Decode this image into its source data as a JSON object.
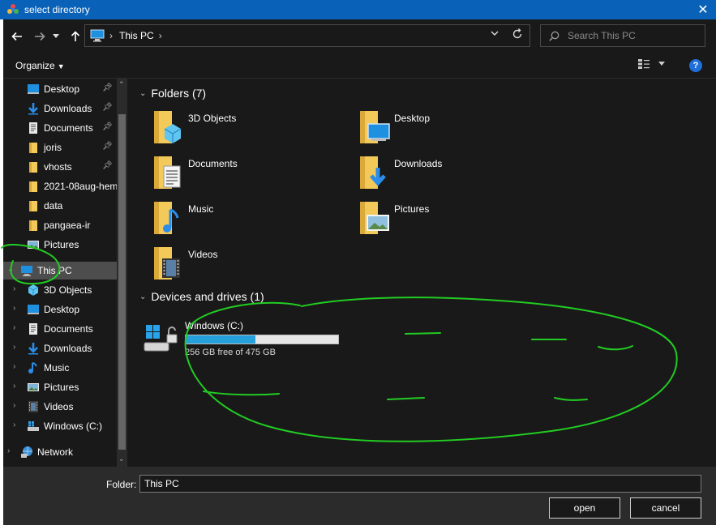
{
  "window": {
    "title": "select directory",
    "close_icon": "close-icon"
  },
  "nav": {
    "back_icon": "arrow-left-icon",
    "forward_icon": "arrow-right-icon",
    "recent_icon": "chevron-down-icon",
    "up_icon": "arrow-up-icon",
    "address": {
      "crumbs": [
        "This PC"
      ],
      "separator": "›",
      "dropdown_icon": "chevron-down-icon",
      "refresh_icon": "refresh-icon"
    },
    "search": {
      "placeholder": "Search This PC",
      "value": "",
      "icon": "search-icon"
    }
  },
  "toolbar": {
    "organize_label": "Organize",
    "view_icon": "view-details-icon",
    "help_label": "?"
  },
  "sidebar": {
    "quick_access": [
      {
        "label": "Desktop",
        "icon": "desktop-icon",
        "pinned": true
      },
      {
        "label": "Downloads",
        "icon": "downloads-icon",
        "pinned": true
      },
      {
        "label": "Documents",
        "icon": "documents-icon",
        "pinned": true
      },
      {
        "label": "joris",
        "icon": "folder-icon",
        "pinned": true
      },
      {
        "label": "vhosts",
        "icon": "folder-icon",
        "pinned": true
      },
      {
        "label": "2021-08aug-hem",
        "icon": "folder-icon",
        "pinned": false
      },
      {
        "label": "data",
        "icon": "folder-icon",
        "pinned": false
      },
      {
        "label": "pangaea-ir",
        "icon": "folder-icon",
        "pinned": false
      },
      {
        "label": "Pictures",
        "icon": "pictures-icon",
        "pinned": false
      }
    ],
    "this_pc": {
      "label": "This PC",
      "icon": "this-pc-icon",
      "expanded": true,
      "selected": true
    },
    "this_pc_children": [
      {
        "label": "3D Objects",
        "icon": "3d-objects-icon"
      },
      {
        "label": "Desktop",
        "icon": "desktop-icon"
      },
      {
        "label": "Documents",
        "icon": "documents-icon"
      },
      {
        "label": "Downloads",
        "icon": "downloads-icon"
      },
      {
        "label": "Music",
        "icon": "music-icon"
      },
      {
        "label": "Pictures",
        "icon": "pictures-icon"
      },
      {
        "label": "Videos",
        "icon": "videos-icon"
      },
      {
        "label": "Windows (C:)",
        "icon": "drive-icon"
      }
    ],
    "network": {
      "label": "Network",
      "icon": "network-icon"
    }
  },
  "content": {
    "folders_header": "Folders (7)",
    "folders": [
      {
        "label": "3D Objects",
        "icon": "3d-objects-folder-icon"
      },
      {
        "label": "Desktop",
        "icon": "desktop-folder-icon"
      },
      {
        "label": "Documents",
        "icon": "documents-folder-icon"
      },
      {
        "label": "Downloads",
        "icon": "downloads-folder-icon"
      },
      {
        "label": "Music",
        "icon": "music-folder-icon"
      },
      {
        "label": "Pictures",
        "icon": "pictures-folder-icon"
      },
      {
        "label": "Videos",
        "icon": "videos-folder-icon"
      }
    ],
    "devices_header": "Devices and drives (1)",
    "drives": [
      {
        "label": "Windows (C:)",
        "free_text": "256 GB free of 475 GB",
        "used_fraction": 0.46,
        "icon": "windows-drive-icon"
      }
    ]
  },
  "footer": {
    "folder_label": "Folder:",
    "folder_value": "This PC",
    "open_label": "open",
    "cancel_label": "cancel"
  },
  "colors": {
    "titlebar": "#0a62b8",
    "background": "#191919",
    "selected": "#4d4d4d",
    "drive_fill": "#26a0da",
    "annotation": "#22cc22",
    "folder_yellow": "#f3c95a"
  }
}
